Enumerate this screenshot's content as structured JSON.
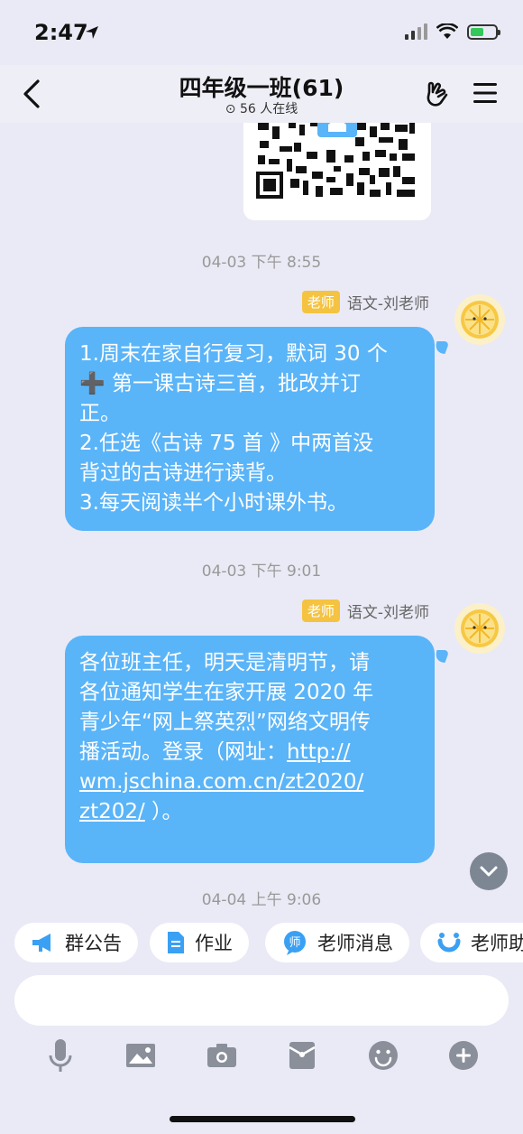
{
  "status_bar": {
    "time": "2:47"
  },
  "header": {
    "title": "四年级一班(61)",
    "online": "56 人在线"
  },
  "messages": [
    {
      "timestamp": "04-03 下午 8:55",
      "role_badge": "老师",
      "sender": "语文-刘老师",
      "lines": [
        "1.周末在家自行复习，默词 30 个",
        "➕ 第一课古诗三首，批改并订",
        "正。",
        "2.任选《古诗 75 首 》中两首没",
        "背过的古诗进行读背。",
        "3.每天阅读半个小时课外书。"
      ]
    },
    {
      "timestamp": "04-03 下午 9:01",
      "role_badge": "老师",
      "sender": "语文-刘老师",
      "lines": [
        "各位班主任，明天是清明节，请",
        "各位通知学生在家开展 2020 年",
        "青少年“网上祭英烈”网络文明传"
      ],
      "line4_text": "播活动。登录（网址：",
      "link_part1": "http://",
      "link_part2": "wm.jschina.com.cn/zt2020/",
      "link_part3": "zt202/",
      "tail_text": " ）。"
    }
  ],
  "last_timestamp": "04-04 上午 9:06",
  "quick_actions": [
    {
      "label": "群公告",
      "icon": "megaphone-icon"
    },
    {
      "label": "作业",
      "icon": "document-icon"
    },
    {
      "label": "老师消息",
      "icon": "teacher-icon"
    },
    {
      "label": "老师助",
      "icon": "assistant-icon"
    }
  ],
  "input": {
    "placeholder": ""
  },
  "toolbar_icons": [
    "microphone-icon",
    "image-icon",
    "camera-icon",
    "red-packet-icon",
    "emoji-icon",
    "plus-icon"
  ],
  "colors": {
    "bubble": "#5ab4f8",
    "badge": "#f5c342",
    "background": "#eaeaf6"
  }
}
